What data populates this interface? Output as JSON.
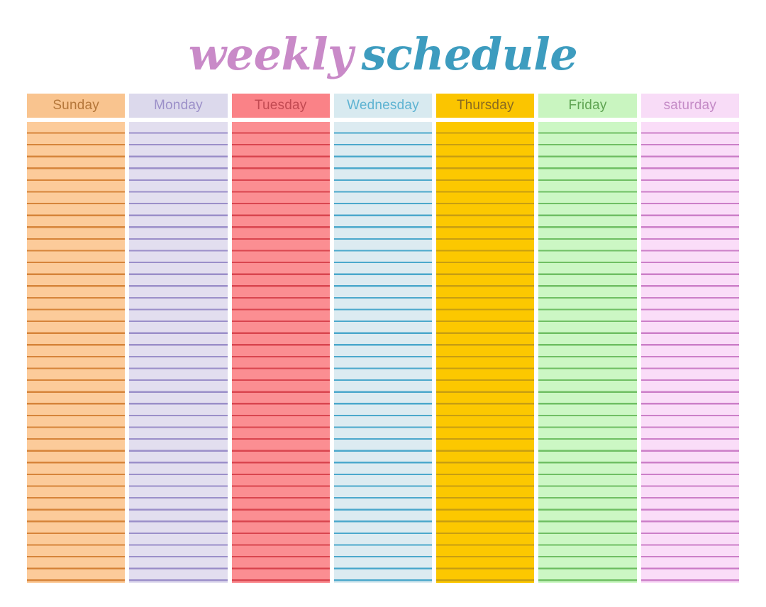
{
  "title": {
    "part_one": "weekly",
    "part_two": "schedule",
    "part_one_color": "#C98AC8",
    "part_two_color": "#3D9CBF"
  },
  "calendar": {
    "row_line_spacing_px": 16.6,
    "row_line_count": 40,
    "days": [
      {
        "name": "Sunday",
        "header_bg": "#F9C48F",
        "header_text_color": "#B5773A",
        "body_bg": "#FCCB9A",
        "line_color": "#D6843A"
      },
      {
        "name": "Monday",
        "header_bg": "#DCD9EC",
        "header_text_color": "#9C90C9",
        "body_bg": "#E2DEEF",
        "line_color": "#9B8FC9"
      },
      {
        "name": "Tuesday",
        "header_bg": "#FA8287",
        "header_text_color": "#C24A52",
        "body_bg": "#FB8E92",
        "line_color": "#D9454F"
      },
      {
        "name": "Wednesday",
        "header_bg": "#D8EAF0",
        "header_text_color": "#5EB3D2",
        "body_bg": "#DCEBF1",
        "line_color": "#4BA8CC"
      },
      {
        "name": "Thursday",
        "header_bg": "#FBC500",
        "header_text_color": "#8A6B20",
        "body_bg": "#FCC800",
        "line_color": "#C79E12"
      },
      {
        "name": "Friday",
        "header_bg": "#C9F5C0",
        "header_text_color": "#5FA452",
        "body_bg": "#CCF7C4",
        "line_color": "#6FBF63"
      },
      {
        "name": "saturday",
        "header_bg": "#F8DCF7",
        "header_text_color": "#C48AC6",
        "body_bg": "#FADDF8",
        "line_color": "#CC7FC8"
      }
    ]
  }
}
